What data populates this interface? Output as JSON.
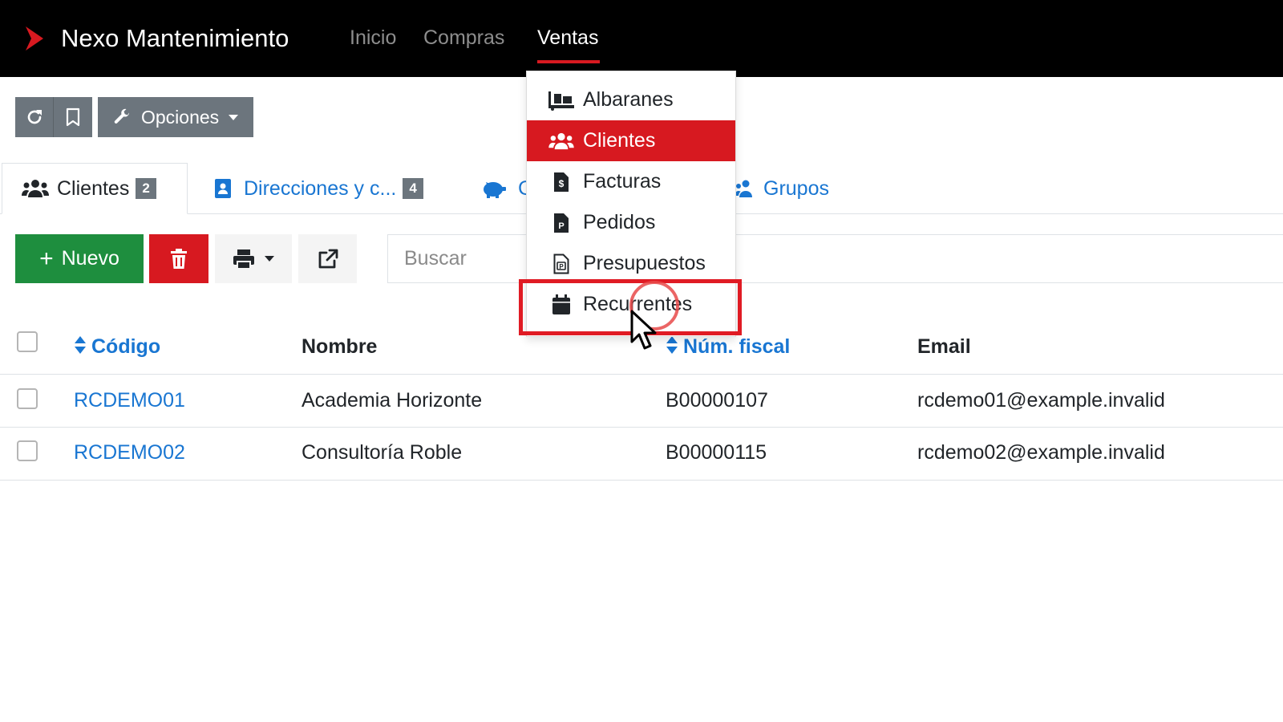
{
  "navbar": {
    "brand": "Nexo Mantenimiento",
    "links": [
      {
        "label": "Inicio"
      },
      {
        "label": "Compras"
      },
      {
        "label": "Ventas"
      }
    ],
    "active_link": "Ventas",
    "colors": {
      "background": "#000000",
      "accent": "#d71920"
    }
  },
  "toolbar": {
    "reload_icon": "reload-icon",
    "bookmark_icon": "bookmark-icon",
    "options_label": "Opciones"
  },
  "tabs": [
    {
      "label": "Clientes",
      "badge": "2",
      "icon": "users-icon",
      "active": true
    },
    {
      "label": "Direcciones y c...",
      "badge": "4",
      "icon": "address-book-icon"
    },
    {
      "label": "C",
      "icon": "piggy-bank-icon"
    },
    {
      "label": "Grupos",
      "icon": "users-group-icon"
    }
  ],
  "actions": {
    "new_label": "Nuevo",
    "search_placeholder": "Buscar",
    "colors": {
      "new": "#1e8e3e",
      "delete": "#d71920"
    }
  },
  "table": {
    "headers": {
      "code": "Código",
      "name": "Nombre",
      "fiscal": "Núm. fiscal",
      "email": "Email"
    },
    "rows": [
      {
        "code": "RCDEMO01",
        "name": "Academia Horizonte",
        "fiscal": "B00000107",
        "email": "rcdemo01@example.invalid"
      },
      {
        "code": "RCDEMO02",
        "name": "Consultoría Roble",
        "fiscal": "B00000115",
        "email": "rcdemo02@example.invalid"
      }
    ]
  },
  "dropdown": {
    "items": [
      {
        "label": "Albaranes",
        "icon": "dolly-icon"
      },
      {
        "label": "Clientes",
        "icon": "users-icon",
        "active": true
      },
      {
        "label": "Facturas",
        "icon": "invoice-icon"
      },
      {
        "label": "Pedidos",
        "icon": "order-file-icon"
      },
      {
        "label": "Presupuestos",
        "icon": "estimate-file-icon"
      },
      {
        "label": "Recurrentes",
        "icon": "calendar-icon",
        "highlighted": true
      }
    ]
  }
}
